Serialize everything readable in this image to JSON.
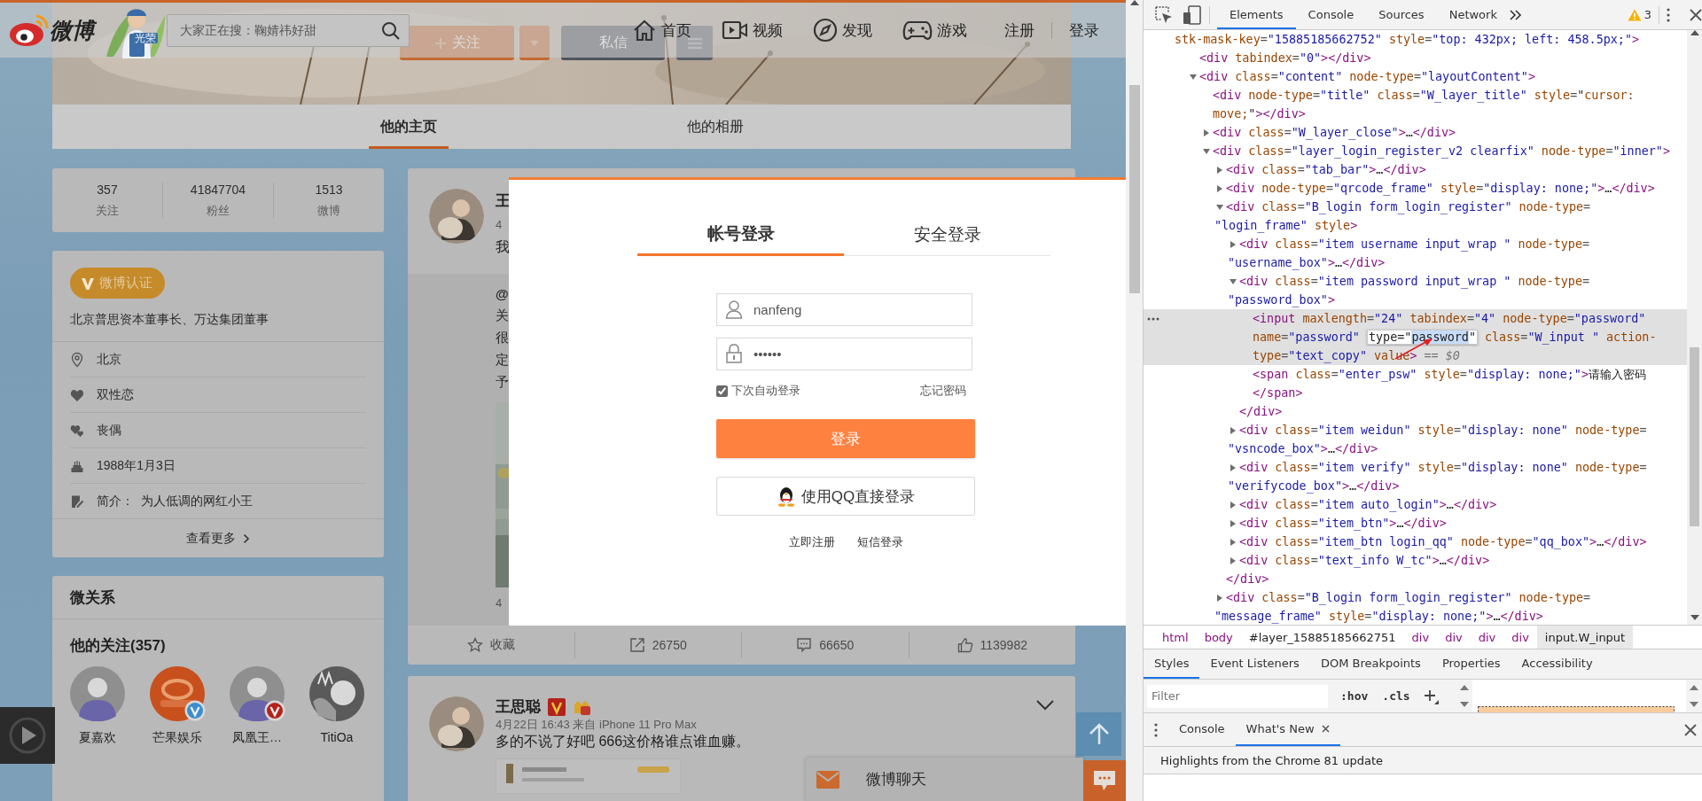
{
  "page": {
    "nav": {
      "logo": "微博",
      "mascot_badge": "光荣",
      "search": {
        "placeholder": "大家正在搜：鞠婧祎好甜"
      },
      "links": [
        {
          "kind": "home",
          "label": "首页"
        },
        {
          "kind": "video",
          "label": "视频"
        },
        {
          "kind": "compass",
          "label": "发现"
        },
        {
          "kind": "gamepad",
          "label": "游戏"
        }
      ],
      "auth": [
        {
          "label": "注册"
        },
        {
          "label": "登录"
        }
      ]
    },
    "profile_actions": [
      {
        "kind": "follow",
        "label": "关注"
      },
      {
        "kind": "dropdown"
      },
      {
        "kind": "message",
        "label": "私信"
      },
      {
        "kind": "menu"
      }
    ],
    "profile_tabs": [
      {
        "label": "他的主页",
        "selected": true
      },
      {
        "label": "他的相册",
        "selected": false
      }
    ],
    "stats": [
      {
        "value": "357",
        "label": "关注"
      },
      {
        "value": "41847704",
        "label": "粉丝"
      },
      {
        "value": "1513",
        "label": "微博"
      }
    ],
    "verification": {
      "badge": "微博认证",
      "description": "北京普思资本董事长、万达集团董事"
    },
    "info": [
      {
        "kind": "location",
        "text": "北京"
      },
      {
        "kind": "heart",
        "text": "双性恋"
      },
      {
        "kind": "hearts",
        "text": "丧偶"
      },
      {
        "kind": "cake",
        "text": "1988年1月3日"
      },
      {
        "kind": "note",
        "text": "简介：  为人低调的网红小王"
      }
    ],
    "more_link": "查看更多",
    "relations": {
      "title": "微关系",
      "following_title": "他的关注(357)",
      "following": [
        {
          "name": "夏嘉欢",
          "kind": "person"
        },
        {
          "name": "芒果娱乐",
          "kind": "logo",
          "badge": {
            "color": "#3b8ed0"
          }
        },
        {
          "name": "凤凰王…",
          "kind": "person",
          "badge": {
            "color": "#b3231b"
          }
        },
        {
          "name": "TitiOa",
          "kind": "cartoon"
        }
      ]
    },
    "post_1": {
      "name": "王",
      "time": "4",
      "text": "我",
      "repost_lines": [
        "@",
        "关",
        "很",
        "定",
        "予"
      ],
      "repost_time": "4",
      "actions": [
        {
          "kind": "star",
          "label": "收藏"
        },
        {
          "kind": "share",
          "label": "26750"
        },
        {
          "kind": "comment",
          "label": "66650"
        },
        {
          "kind": "like",
          "label": "1139982"
        }
      ]
    },
    "post_2": {
      "name": "王思聪",
      "time": "4月22日 16:43 来自 iPhone 11 Pro Max",
      "text": "多的不说了好吧 666这价格谁点谁血赚。"
    },
    "chat": {
      "label": "微博聊天"
    }
  },
  "login_dialog": {
    "tabs": [
      {
        "label": "帐号登录",
        "selected": true
      },
      {
        "label": "安全登录",
        "selected": false
      }
    ],
    "username": {
      "value": "nanfeng"
    },
    "password": {
      "value": "••••••"
    },
    "remember": {
      "label": "下次自动登录",
      "checked": true
    },
    "forgot_link": "忘记密码",
    "login_button": "登录",
    "qq_button": "使用QQ直接登录",
    "links": [
      "立即注册",
      "短信登录"
    ]
  },
  "devtools": {
    "tabs": [
      {
        "label": "Elements",
        "selected": true
      },
      {
        "label": "Console",
        "selected": false
      },
      {
        "label": "Sources",
        "selected": false
      },
      {
        "label": "Network",
        "selected": false
      }
    ],
    "warnings": "3",
    "elements_tree": {
      "lines": [
        "stk-mask-key=\"15885185662752\" style=\"top: 432px; left: 458.5px;\">"
      ],
      "children": [
        {
          "selected": false,
          "lines": [
            "<div tabindex=\"0\"></div>"
          ]
        },
        {
          "selected": false,
          "expanded": true,
          "lines": [
            "<div class=\"content\" node-type=\"layoutContent\">"
          ],
          "children": [
            {
              "selected": false,
              "lines": [
                "<div node-type=\"title\" class=\"W_layer_title\" style=\"cursor:",
                "move;\"></div>"
              ]
            },
            {
              "selected": false,
              "expanded": false,
              "lines": [
                "<div class=\"W_layer_close\">…</div>"
              ]
            },
            {
              "selected": false,
              "expanded": true,
              "lines": [
                "<div class=\"layer_login_register_v2 clearfix\" node-type=\"inner\">"
              ],
              "children": [
                {
                  "selected": false,
                  "expanded": false,
                  "lines": [
                    "<div class=\"tab_bar\">…</div>"
                  ]
                },
                {
                  "selected": false,
                  "expanded": false,
                  "lines": [
                    "<div node-type=\"qrcode_frame\" style=\"display: none;\">…</div>"
                  ]
                },
                {
                  "selected": false,
                  "expanded": true,
                  "lines": [
                    "<div class=\"B_login form_login_register\" node-type=",
                    "\"login_frame\" style>"
                  ],
                  "children": [
                    {
                      "selected": false,
                      "expanded": false,
                      "lines": [
                        "<div class=\"item username input_wrap \" node-type=",
                        "\"username_box\">…</div>"
                      ]
                    },
                    {
                      "selected": false,
                      "expanded": true,
                      "lines": [
                        "<div class=\"item password input_wrap \" node-type=",
                        "\"password_box\">"
                      ],
                      "children": [
                        {
                          "selected": true,
                          "lines": [
                            "<input maxlength=\"24\" tabindex=\"4\" node-type=\"password\"",
                            {
                              "before": "name=\"password\" ",
                              "editor": {
                                "prefix": "type=\"",
                                "selection": "password",
                                "suffix": "\""
                              },
                              "after": " class=\"W_input \" action-"
                            },
                            "type=\"text_copy\" value> == $0"
                          ]
                        },
                        {
                          "selected": false,
                          "lines": [
                            "<span class=\"enter_psw\" style=\"display: none;\">请输入密码",
                            "</span>"
                          ]
                        }
                      ],
                      "close": "</div>"
                    },
                    {
                      "selected": false,
                      "expanded": false,
                      "lines": [
                        "<div class=\"item weidun\" style=\"display: none\" node-type=",
                        "\"vsncode_box\">…</div>"
                      ]
                    },
                    {
                      "selected": false,
                      "expanded": false,
                      "lines": [
                        "<div class=\"item verify\" style=\"display: none\" node-type=",
                        "\"verifycode_box\">…</div>"
                      ]
                    },
                    {
                      "selected": false,
                      "expanded": false,
                      "lines": [
                        "<div class=\"item auto_login\">…</div>"
                      ]
                    },
                    {
                      "selected": false,
                      "expanded": false,
                      "lines": [
                        "<div class=\"item_btn\">…</div>"
                      ]
                    },
                    {
                      "selected": false,
                      "expanded": false,
                      "lines": [
                        "<div class=\"item_btn login_qq\" node-type=\"qq_box\">…</div>"
                      ]
                    },
                    {
                      "selected": false,
                      "expanded": false,
                      "lines": [
                        "<div class=\"text_info W_tc\">…</div>"
                      ]
                    }
                  ],
                  "close": "</div>"
                },
                {
                  "selected": false,
                  "expanded": false,
                  "lines": [
                    "<div class=\"B_login form_login_register\" node-type=",
                    "\"message_frame\" style=\"display: none;\">…</div>"
                  ]
                }
              ]
            }
          ]
        }
      ]
    },
    "breadcrumbs": [
      {
        "label": "html",
        "kind": "tag",
        "selected": false
      },
      {
        "label": "body",
        "kind": "tag",
        "selected": false
      },
      {
        "label": "#layer_15885185662751",
        "kind": "id",
        "selected": false
      },
      {
        "label": "div",
        "kind": "tag",
        "selected": false
      },
      {
        "label": "div",
        "kind": "tag",
        "selected": false
      },
      {
        "label": "div",
        "kind": "tag",
        "selected": false
      },
      {
        "label": "div",
        "kind": "tag",
        "selected": false
      },
      {
        "label": "input.W_input",
        "kind": "tag",
        "selected": true
      }
    ],
    "sidebar_tabs": [
      {
        "label": "Styles",
        "selected": true
      },
      {
        "label": "Event Listeners",
        "selected": false
      },
      {
        "label": "DOM Breakpoints",
        "selected": false
      },
      {
        "label": "Properties",
        "selected": false
      },
      {
        "label": "Accessibility",
        "selected": false
      }
    ],
    "filter": {
      "placeholder": "Filter"
    },
    "filter_buttons": [
      ":hov",
      ".cls"
    ],
    "drawer_tabs": [
      {
        "label": "Console",
        "selected": false,
        "closable": false
      },
      {
        "label": "What's New",
        "selected": true,
        "closable": true
      }
    ],
    "whats_new": "Highlights from the Chrome 81 update"
  }
}
